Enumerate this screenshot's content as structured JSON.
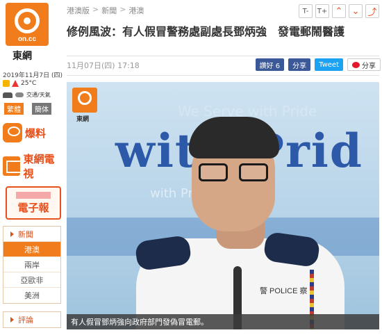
{
  "brand": {
    "logo_text": "on.cc",
    "name": "東網"
  },
  "info": {
    "date": "2019年11月7日 (四)",
    "temperature": "25°C",
    "traffic_label": "交通/天氣"
  },
  "languages": {
    "traditional": "繁體",
    "simplified": "簡体"
  },
  "promos": {
    "scoop": "爆料",
    "tv": "東網電視",
    "epaper": "電子報"
  },
  "nav": {
    "header": "新聞",
    "items": [
      "港澳",
      "兩岸",
      "亞歐非",
      "美洲"
    ],
    "active_index": 0,
    "comments": "評論"
  },
  "breadcrumb": [
    "港澳版",
    "新聞",
    "港澳"
  ],
  "toolbar": {
    "font_smaller": "T-",
    "font_larger": "T+",
    "up": "⌃",
    "down": "⌄",
    "share": "⤴"
  },
  "article": {
    "headline": "修例風波：有人假冒警務處副處長鄧炳強　發電郵鬧醫護",
    "timestamp": "11月07日(四) 17:18",
    "caption": "有人假冒鄧炳強向政府部門發偽冒電郵。"
  },
  "share": {
    "fb_like": "讚好 6",
    "fb_share": "分享",
    "tweet": "Tweet",
    "weibo": "分享"
  },
  "photo": {
    "watermark_logo": "on.cc",
    "watermark_name": "東網",
    "background_text": "with Prid",
    "badge_text": "警 POLICE 察"
  }
}
